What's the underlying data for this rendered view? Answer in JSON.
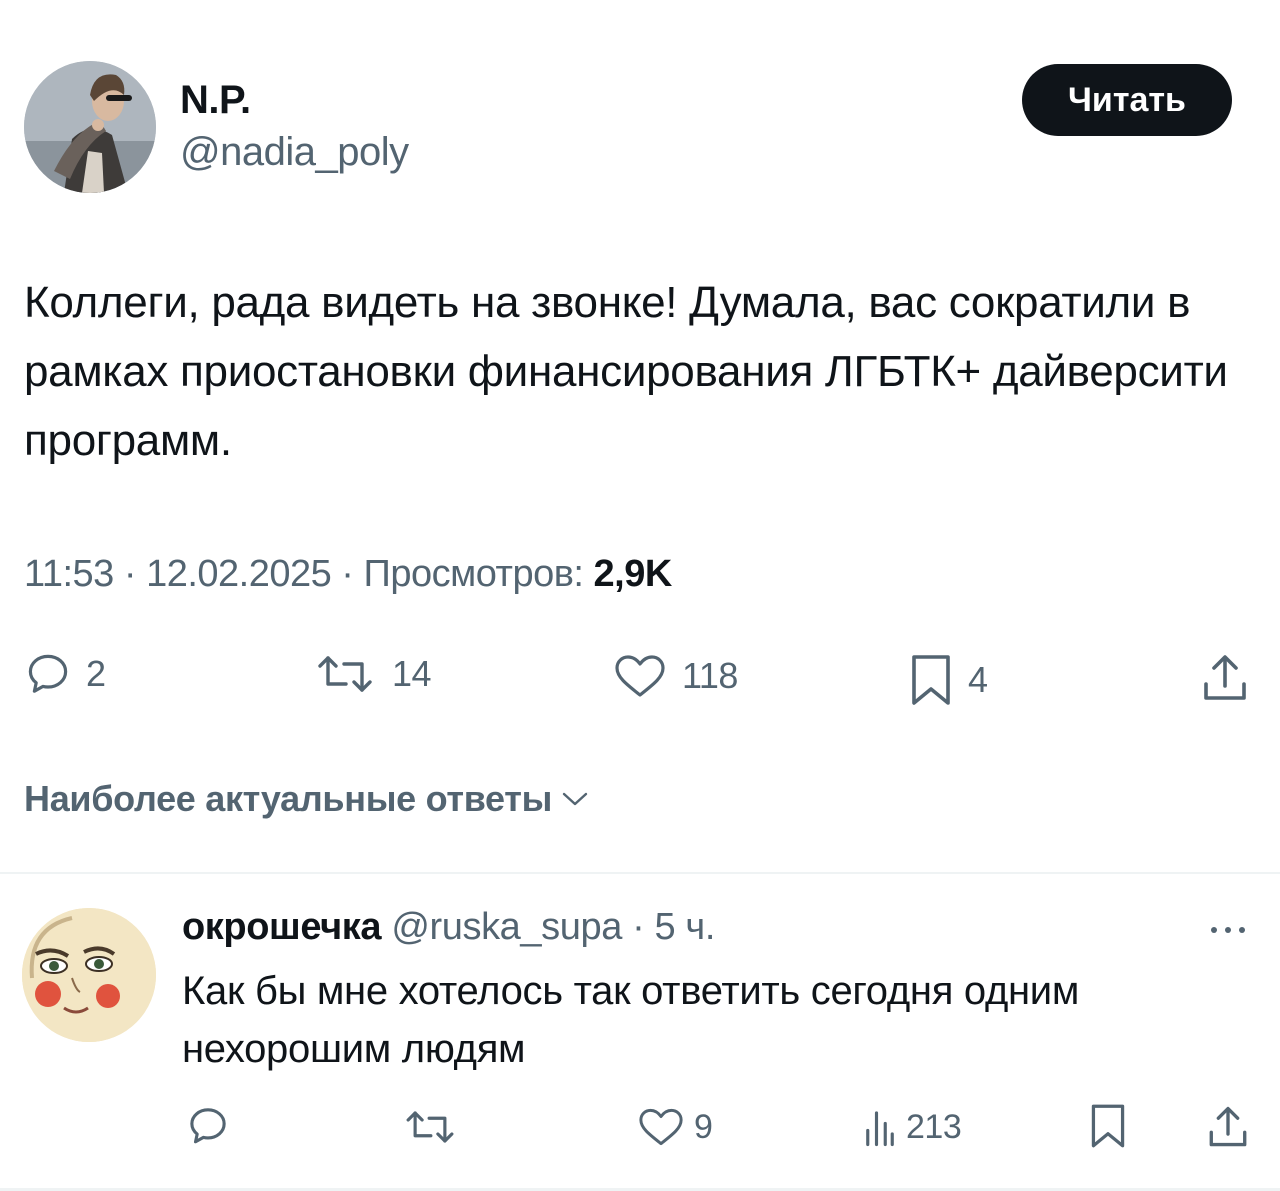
{
  "author": {
    "name": "N.P.",
    "handle": "@nadia_poly",
    "follow_label": "Читать"
  },
  "tweet": {
    "text": "Коллеги, рада видеть на звонке! Думала, вас сократили в рамках приостановки финансирования ЛГБТК+ дайверсити программ.",
    "time": "11:53",
    "sep1": " · ",
    "date": "12.02.2025",
    "sep2": " · ",
    "views_label": "Просмотров: ",
    "views_count": "2,9K",
    "actions": {
      "replies": "2",
      "retweets": "14",
      "likes": "118",
      "bookmarks": "4"
    }
  },
  "replies_sort_label": "Наиболее актуальные ответы",
  "reply": {
    "name": "окрошечка",
    "handle": "@ruska_supa",
    "separator": " · ",
    "time": "5 ч.",
    "text": "Как бы мне хотелось так ответить сегодня одним нехорошим людям",
    "actions": {
      "likes": "9",
      "views": "213"
    }
  },
  "colors": {
    "text_primary": "#0f1419",
    "text_secondary": "#536471",
    "divider": "#eff3f4",
    "button_bg": "#0f1419"
  },
  "icons": {
    "reply": "speech-bubble-icon",
    "retweet": "retweet-arrows-icon",
    "like": "heart-icon",
    "bookmark": "bookmark-icon",
    "share": "share-upload-icon",
    "views": "bar-chart-icon",
    "more": "ellipsis-icon",
    "sort": "chevron-down-icon"
  }
}
